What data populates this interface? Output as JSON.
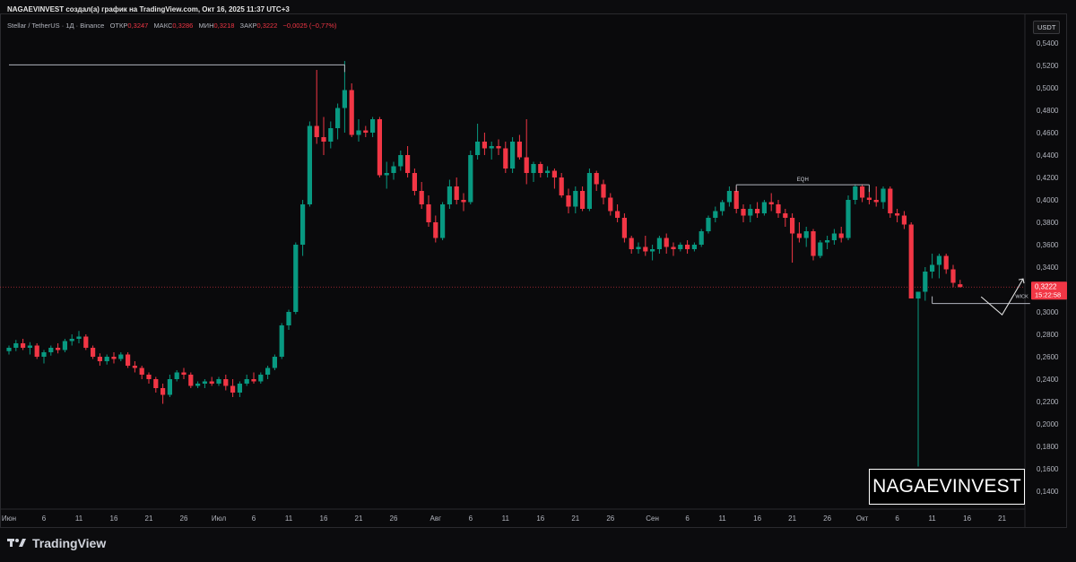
{
  "header": "NAGAEVINVEST создал(а) график на TradingView.com, Окт 16, 2025 11:37 UTC+3",
  "legend": {
    "symbol": "Stellar / TetherUS · 1Д · Binance",
    "open_label": "ОТКР",
    "open": "0,3247",
    "high_label": "МАКС",
    "high": "0,3286",
    "low_label": "МИН",
    "low": "0,3218",
    "close_label": "ЗАКР",
    "close": "0,3222",
    "change": "−0,0025 (−0,77%)"
  },
  "currency": "USDT",
  "price_tag": {
    "price": "0,3222",
    "countdown": "15:22:58"
  },
  "watermark": "NAGAEVINVEST",
  "brand": "TradingView",
  "colors": {
    "up": "#089981",
    "down": "#f23645",
    "background": "#0a0a0c",
    "annotation": "#b2b5be"
  },
  "chart_data": {
    "type": "candlestick",
    "y_axis": {
      "range": [
        0.128,
        0.552
      ],
      "ticks": [
        "0,5400",
        "0,5200",
        "0,5000",
        "0,4800",
        "0,4600",
        "0,4400",
        "0,4200",
        "0,4000",
        "0,3800",
        "0,3600",
        "0,3400",
        "0,3200",
        "0,3000",
        "0,2800",
        "0,2600",
        "0,2400",
        "0,2200",
        "0,2000",
        "0,1800",
        "0,1600",
        "0,1400"
      ]
    },
    "x_axis": {
      "ticks": [
        {
          "day": 0,
          "label": "Июн"
        },
        {
          "day": 5,
          "label": "6"
        },
        {
          "day": 10,
          "label": "11"
        },
        {
          "day": 15,
          "label": "16"
        },
        {
          "day": 20,
          "label": "21"
        },
        {
          "day": 25,
          "label": "26"
        },
        {
          "day": 30,
          "label": "Июл"
        },
        {
          "day": 35,
          "label": "6"
        },
        {
          "day": 40,
          "label": "11"
        },
        {
          "day": 45,
          "label": "16"
        },
        {
          "day": 50,
          "label": "21"
        },
        {
          "day": 55,
          "label": "26"
        },
        {
          "day": 61,
          "label": "Авг"
        },
        {
          "day": 66,
          "label": "6"
        },
        {
          "day": 71,
          "label": "11"
        },
        {
          "day": 76,
          "label": "16"
        },
        {
          "day": 81,
          "label": "21"
        },
        {
          "day": 86,
          "label": "26"
        },
        {
          "day": 92,
          "label": "Сен"
        },
        {
          "day": 97,
          "label": "6"
        },
        {
          "day": 102,
          "label": "11"
        },
        {
          "day": 107,
          "label": "16"
        },
        {
          "day": 112,
          "label": "21"
        },
        {
          "day": 117,
          "label": "26"
        },
        {
          "day": 122,
          "label": "Окт"
        },
        {
          "day": 127,
          "label": "6"
        },
        {
          "day": 132,
          "label": "11"
        },
        {
          "day": 137,
          "label": "16"
        },
        {
          "day": 142,
          "label": "21"
        }
      ]
    },
    "candles": [
      [
        0.265,
        0.27,
        0.262,
        0.268
      ],
      [
        0.268,
        0.275,
        0.265,
        0.272
      ],
      [
        0.272,
        0.276,
        0.266,
        0.268
      ],
      [
        0.268,
        0.273,
        0.262,
        0.27
      ],
      [
        0.27,
        0.272,
        0.258,
        0.26
      ],
      [
        0.26,
        0.266,
        0.254,
        0.264
      ],
      [
        0.264,
        0.27,
        0.261,
        0.268
      ],
      [
        0.268,
        0.272,
        0.263,
        0.266
      ],
      [
        0.266,
        0.276,
        0.264,
        0.274
      ],
      [
        0.274,
        0.28,
        0.27,
        0.276
      ],
      [
        0.276,
        0.283,
        0.272,
        0.278
      ],
      [
        0.278,
        0.28,
        0.266,
        0.268
      ],
      [
        0.268,
        0.27,
        0.258,
        0.26
      ],
      [
        0.26,
        0.263,
        0.252,
        0.256
      ],
      [
        0.256,
        0.262,
        0.253,
        0.26
      ],
      [
        0.26,
        0.264,
        0.254,
        0.258
      ],
      [
        0.258,
        0.264,
        0.256,
        0.262
      ],
      [
        0.262,
        0.264,
        0.25,
        0.252
      ],
      [
        0.252,
        0.256,
        0.246,
        0.25
      ],
      [
        0.25,
        0.252,
        0.24,
        0.244
      ],
      [
        0.244,
        0.246,
        0.236,
        0.24
      ],
      [
        0.24,
        0.242,
        0.228,
        0.232
      ],
      [
        0.232,
        0.236,
        0.218,
        0.226
      ],
      [
        0.226,
        0.244,
        0.224,
        0.24
      ],
      [
        0.24,
        0.248,
        0.238,
        0.246
      ],
      [
        0.246,
        0.25,
        0.24,
        0.244
      ],
      [
        0.244,
        0.246,
        0.232,
        0.234
      ],
      [
        0.234,
        0.238,
        0.232,
        0.236
      ],
      [
        0.236,
        0.24,
        0.232,
        0.238
      ],
      [
        0.238,
        0.242,
        0.234,
        0.236
      ],
      [
        0.236,
        0.242,
        0.234,
        0.24
      ],
      [
        0.24,
        0.244,
        0.23,
        0.234
      ],
      [
        0.234,
        0.24,
        0.224,
        0.228
      ],
      [
        0.228,
        0.238,
        0.224,
        0.236
      ],
      [
        0.236,
        0.244,
        0.234,
        0.24
      ],
      [
        0.24,
        0.246,
        0.236,
        0.238
      ],
      [
        0.238,
        0.246,
        0.236,
        0.244
      ],
      [
        0.244,
        0.252,
        0.24,
        0.25
      ],
      [
        0.25,
        0.262,
        0.248,
        0.26
      ],
      [
        0.26,
        0.29,
        0.258,
        0.288
      ],
      [
        0.288,
        0.302,
        0.284,
        0.3
      ],
      [
        0.3,
        0.362,
        0.298,
        0.36
      ],
      [
        0.36,
        0.4,
        0.35,
        0.396
      ],
      [
        0.396,
        0.47,
        0.394,
        0.466
      ],
      [
        0.466,
        0.516,
        0.45,
        0.456
      ],
      [
        0.456,
        0.474,
        0.44,
        0.452
      ],
      [
        0.452,
        0.47,
        0.446,
        0.464
      ],
      [
        0.464,
        0.486,
        0.454,
        0.482
      ],
      [
        0.482,
        0.524,
        0.46,
        0.498
      ],
      [
        0.498,
        0.504,
        0.456,
        0.458
      ],
      [
        0.458,
        0.472,
        0.452,
        0.462
      ],
      [
        0.462,
        0.466,
        0.456,
        0.46
      ],
      [
        0.46,
        0.474,
        0.456,
        0.472
      ],
      [
        0.472,
        0.474,
        0.42,
        0.422
      ],
      [
        0.422,
        0.434,
        0.41,
        0.424
      ],
      [
        0.424,
        0.434,
        0.418,
        0.43
      ],
      [
        0.43,
        0.444,
        0.426,
        0.44
      ],
      [
        0.44,
        0.448,
        0.42,
        0.424
      ],
      [
        0.424,
        0.428,
        0.404,
        0.408
      ],
      [
        0.408,
        0.416,
        0.392,
        0.396
      ],
      [
        0.396,
        0.404,
        0.376,
        0.38
      ],
      [
        0.38,
        0.386,
        0.362,
        0.366
      ],
      [
        0.366,
        0.398,
        0.364,
        0.396
      ],
      [
        0.396,
        0.418,
        0.392,
        0.412
      ],
      [
        0.412,
        0.42,
        0.396,
        0.4
      ],
      [
        0.4,
        0.406,
        0.39,
        0.398
      ],
      [
        0.398,
        0.444,
        0.396,
        0.44
      ],
      [
        0.44,
        0.468,
        0.436,
        0.452
      ],
      [
        0.452,
        0.46,
        0.44,
        0.446
      ],
      [
        0.446,
        0.452,
        0.436,
        0.448
      ],
      [
        0.448,
        0.454,
        0.44,
        0.446
      ],
      [
        0.446,
        0.452,
        0.424,
        0.428
      ],
      [
        0.428,
        0.456,
        0.424,
        0.452
      ],
      [
        0.452,
        0.458,
        0.436,
        0.438
      ],
      [
        0.438,
        0.472,
        0.414,
        0.424
      ],
      [
        0.424,
        0.434,
        0.416,
        0.432
      ],
      [
        0.432,
        0.434,
        0.42,
        0.424
      ],
      [
        0.424,
        0.43,
        0.42,
        0.426
      ],
      [
        0.426,
        0.428,
        0.41,
        0.42
      ],
      [
        0.42,
        0.424,
        0.402,
        0.404
      ],
      [
        0.404,
        0.41,
        0.388,
        0.394
      ],
      [
        0.394,
        0.412,
        0.388,
        0.408
      ],
      [
        0.408,
        0.412,
        0.39,
        0.392
      ],
      [
        0.392,
        0.428,
        0.39,
        0.424
      ],
      [
        0.424,
        0.426,
        0.408,
        0.414
      ],
      [
        0.414,
        0.418,
        0.396,
        0.402
      ],
      [
        0.402,
        0.406,
        0.386,
        0.39
      ],
      [
        0.39,
        0.396,
        0.38,
        0.384
      ],
      [
        0.384,
        0.388,
        0.362,
        0.366
      ],
      [
        0.366,
        0.368,
        0.352,
        0.356
      ],
      [
        0.356,
        0.362,
        0.352,
        0.358
      ],
      [
        0.358,
        0.368,
        0.35,
        0.354
      ],
      [
        0.354,
        0.36,
        0.346,
        0.356
      ],
      [
        0.356,
        0.368,
        0.352,
        0.366
      ],
      [
        0.366,
        0.37,
        0.352,
        0.358
      ],
      [
        0.358,
        0.362,
        0.35,
        0.356
      ],
      [
        0.356,
        0.362,
        0.354,
        0.36
      ],
      [
        0.36,
        0.364,
        0.352,
        0.356
      ],
      [
        0.356,
        0.362,
        0.354,
        0.36
      ],
      [
        0.36,
        0.374,
        0.358,
        0.372
      ],
      [
        0.372,
        0.386,
        0.37,
        0.384
      ],
      [
        0.384,
        0.394,
        0.38,
        0.39
      ],
      [
        0.39,
        0.4,
        0.386,
        0.398
      ],
      [
        0.398,
        0.412,
        0.394,
        0.408
      ],
      [
        0.408,
        0.412,
        0.388,
        0.392
      ],
      [
        0.392,
        0.396,
        0.38,
        0.386
      ],
      [
        0.386,
        0.396,
        0.38,
        0.392
      ],
      [
        0.392,
        0.398,
        0.384,
        0.388
      ],
      [
        0.388,
        0.4,
        0.386,
        0.398
      ],
      [
        0.398,
        0.406,
        0.39,
        0.396
      ],
      [
        0.396,
        0.4,
        0.384,
        0.388
      ],
      [
        0.388,
        0.392,
        0.376,
        0.384
      ],
      [
        0.384,
        0.388,
        0.344,
        0.37
      ],
      [
        0.37,
        0.38,
        0.362,
        0.366
      ],
      [
        0.366,
        0.376,
        0.358,
        0.372
      ],
      [
        0.372,
        0.374,
        0.346,
        0.35
      ],
      [
        0.35,
        0.364,
        0.348,
        0.362
      ],
      [
        0.362,
        0.368,
        0.356,
        0.364
      ],
      [
        0.364,
        0.374,
        0.36,
        0.37
      ],
      [
        0.37,
        0.376,
        0.362,
        0.366
      ],
      [
        0.366,
        0.404,
        0.364,
        0.4
      ],
      [
        0.4,
        0.414,
        0.396,
        0.412
      ],
      [
        0.412,
        0.414,
        0.398,
        0.402
      ],
      [
        0.402,
        0.41,
        0.396,
        0.4
      ],
      [
        0.4,
        0.412,
        0.394,
        0.398
      ],
      [
        0.398,
        0.412,
        0.392,
        0.41
      ],
      [
        0.41,
        0.412,
        0.384,
        0.388
      ],
      [
        0.388,
        0.392,
        0.38,
        0.386
      ],
      [
        0.386,
        0.39,
        0.374,
        0.378
      ],
      [
        0.378,
        0.38,
        0.318,
        0.312
      ],
      [
        0.312,
        0.318,
        0.162,
        0.318
      ],
      [
        0.318,
        0.34,
        0.31,
        0.336
      ],
      [
        0.336,
        0.352,
        0.33,
        0.342
      ],
      [
        0.342,
        0.352,
        0.33,
        0.35
      ],
      [
        0.35,
        0.352,
        0.334,
        0.338
      ],
      [
        0.338,
        0.342,
        0.322,
        0.326
      ],
      [
        0.3247,
        0.3286,
        0.3218,
        0.3222
      ]
    ],
    "annotations": [
      {
        "type": "hline",
        "from_day": 0,
        "to_day": 48,
        "price": 0.5205
      },
      {
        "type": "hline",
        "label": "EQH",
        "from_day": 104,
        "to_day": 123,
        "price": 0.4135
      },
      {
        "type": "hline",
        "label": "WICK",
        "from_day": 132,
        "to_day": 146,
        "price": 0.3075
      },
      {
        "type": "path",
        "points": [
          [
            139,
            0.3135
          ],
          [
            142,
            0.2975
          ],
          [
            145,
            0.3295
          ]
        ]
      }
    ]
  }
}
